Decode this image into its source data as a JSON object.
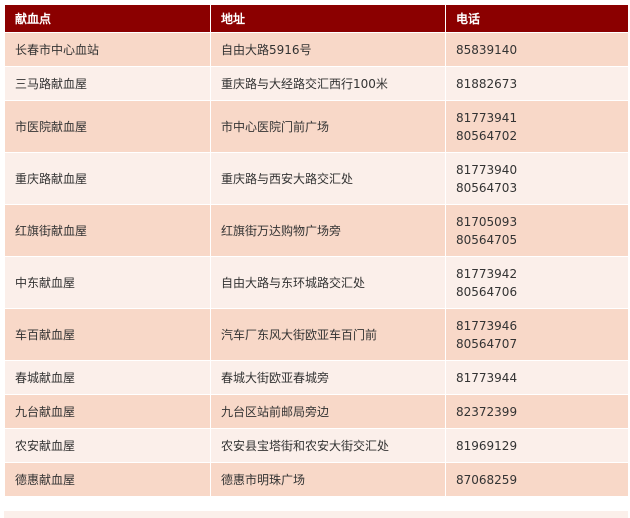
{
  "headers": {
    "site": "献血点",
    "address": "地址",
    "phone": "电话"
  },
  "rows": [
    {
      "site": "长春市中心血站",
      "address": "自由大路5916号",
      "phones": [
        "85839140"
      ]
    },
    {
      "site": "三马路献血屋",
      "address": "重庆路与大经路交汇西行100米",
      "phones": [
        "81882673"
      ]
    },
    {
      "site": "市医院献血屋",
      "address": "市中心医院门前广场",
      "phones": [
        "81773941",
        "80564702"
      ]
    },
    {
      "site": "重庆路献血屋",
      "address": "重庆路与西安大路交汇处",
      "phones": [
        "81773940",
        "80564703"
      ]
    },
    {
      "site": "红旗街献血屋",
      "address": "红旗街万达购物广场旁",
      "phones": [
        "81705093",
        "80564705"
      ]
    },
    {
      "site": "中东献血屋",
      "address": "自由大路与东环城路交汇处",
      "phones": [
        "81773942",
        "80564706"
      ]
    },
    {
      "site": "车百献血屋",
      "address": "汽车厂东风大街欧亚车百门前",
      "phones": [
        "81773946",
        "80564707"
      ]
    },
    {
      "site": "春城献血屋",
      "address": "春城大街欧亚春城旁",
      "phones": [
        "81773944"
      ]
    },
    {
      "site": "九台献血屋",
      "address": "九台区站前邮局旁边",
      "phones": [
        "82372399"
      ]
    },
    {
      "site": "农安献血屋",
      "address": "农安县宝塔街和农安大街交汇处",
      "phones": [
        "81969129"
      ]
    },
    {
      "site": "德惠献血屋",
      "address": "德惠市明珠广场",
      "phones": [
        "87068259"
      ]
    }
  ]
}
